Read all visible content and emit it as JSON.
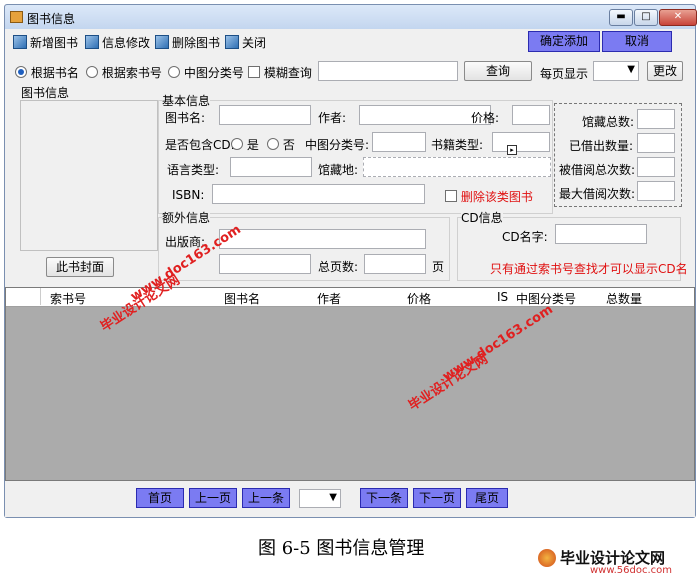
{
  "window": {
    "title": "图书信息",
    "min_glyph": "▬",
    "max_glyph": "□",
    "close_glyph": "✕"
  },
  "toolbar": {
    "add": "新增图书",
    "edit": "信息修改",
    "delete": "删除图书",
    "close": "关闭",
    "confirm_add": "确定添加",
    "cancel": "取消"
  },
  "search": {
    "by_name": "根据书名",
    "by_index": "根据索书号",
    "by_class": "中图分类号",
    "fuzzy": "模糊查询",
    "query_value": "",
    "query_button": "查询",
    "per_page_label": "每页显示",
    "per_page_value": "",
    "change_button": "更改"
  },
  "book_info": {
    "group": "图书信息",
    "cover_button": "此书封面"
  },
  "basic": {
    "group": "基本信息",
    "title": "图书名:",
    "author": "作者:",
    "price": "价格:",
    "has_cd": "是否包含CD:",
    "yes": "是",
    "no": "否",
    "class_no": "中图分类号:",
    "type": "书籍类型:",
    "lang": "语言类型:",
    "location": "馆藏地:",
    "isbn": "ISBN:",
    "delete_type": "删除该类图书"
  },
  "stats": {
    "total": "馆藏总数:",
    "borrowed": "已借出数量:",
    "borrow_count": "被借阅总次数:",
    "max_borrow": "最大借阅次数:"
  },
  "extra": {
    "group": "额外信息",
    "publisher": "出版商:",
    "pages": "总页数:",
    "page_unit": "页"
  },
  "cd": {
    "group": "CD信息",
    "name": "CD名字:",
    "note": "只有通过索书号查找才可以显示CD名"
  },
  "grid": {
    "columns": [
      "索书号",
      "图书名",
      "作者",
      "价格",
      "IS",
      "中图分类号",
      "总数量"
    ]
  },
  "pager": {
    "first": "首页",
    "prev_page": "上一页",
    "prev_item": "上一条",
    "page_value": "",
    "next_item": "下一条",
    "next_page": "下一页",
    "last": "尾页"
  },
  "caption": "图 6-5 图书信息管理",
  "watermarks": {
    "site_cn": "毕业设计论文网",
    "site_url": "www.doc163.com",
    "footer_logo": "毕业设计论文网",
    "footer_url": "www.56doc.com"
  }
}
